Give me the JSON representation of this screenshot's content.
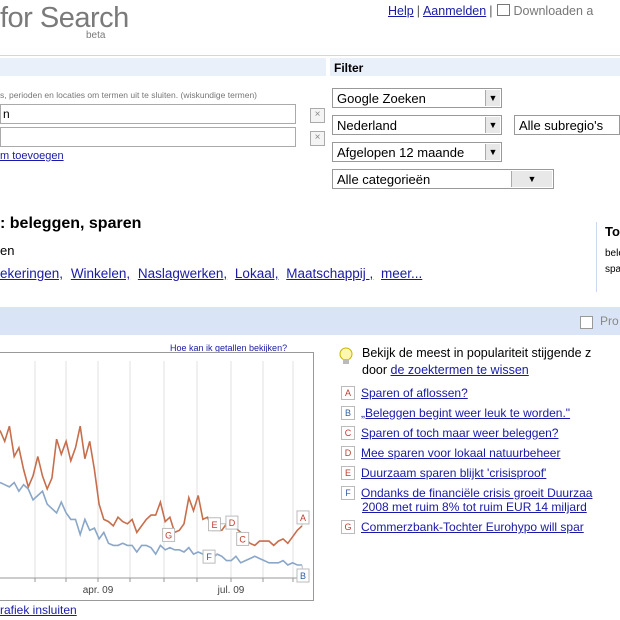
{
  "header": {
    "logo_text": "for Search",
    "beta": "beta",
    "links": {
      "help": "Help",
      "login": "Aanmelden",
      "download": "Downloaden a"
    }
  },
  "search_panel": {
    "hint": "s, perioden en locaties om termen uit te sluiten. (wiskundige termen)",
    "term1_value": "n",
    "term2_value": "",
    "add_term_link": "m toevoegen"
  },
  "filter": {
    "label": "Filter",
    "search_type": "Google Zoeken",
    "country": "Nederland",
    "subregion": "Alle subregio's",
    "period": "Afgelopen 12 maande",
    "category": "Alle categorieën"
  },
  "results": {
    "title": ": beleggen, sparen",
    "subtitle": "en",
    "categories": [
      "ekeringen,",
      "Winkelen,",
      "Naslagwerken,",
      "Lokaal,",
      "Maatschappij ,",
      "meer..."
    ],
    "right_box": {
      "title": "To",
      "line1": "bele",
      "line2": "spa"
    }
  },
  "band": {
    "label": "Pro"
  },
  "chart": {
    "how_link": "Hoe kan ik getallen bekijken?",
    "embed_link": "rafiek insluiten",
    "x_ticks": [
      "apr. 09",
      "jul. 09"
    ]
  },
  "chart_data": {
    "type": "line",
    "title": "",
    "xlabel": "",
    "ylabel": "",
    "x_ticks": [
      "apr. 09",
      "jul. 09"
    ],
    "series": [
      {
        "color": "#c76e4c",
        "values": [
          68,
          63,
          70,
          56,
          60,
          50,
          42,
          47,
          56,
          47,
          41,
          46,
          64,
          57,
          63,
          54,
          60,
          70,
          55,
          63,
          50,
          34,
          27,
          26,
          24,
          28,
          26,
          25,
          27,
          21,
          24,
          27,
          29,
          29,
          35,
          26,
          28,
          21,
          22,
          25,
          37,
          31,
          38,
          27,
          28,
          22,
          22,
          22,
          25,
          26,
          23,
          21,
          18,
          16,
          15,
          17,
          17,
          17,
          15,
          17,
          18,
          16,
          19,
          22,
          24
        ]
      },
      {
        "color": "#8aa6c8",
        "values": [
          44,
          43,
          42,
          44,
          40,
          43,
          41,
          36,
          38,
          40,
          34,
          32,
          30,
          35,
          30,
          27,
          27,
          20,
          27,
          22,
          23,
          18,
          21,
          16,
          15,
          15,
          16,
          15,
          15,
          12,
          15,
          15,
          14,
          11,
          15,
          13,
          14,
          13,
          13,
          12,
          14,
          11,
          12,
          11,
          12,
          9,
          11,
          10,
          8,
          8,
          10,
          7,
          8,
          9,
          10,
          9,
          8,
          7,
          7,
          7,
          8,
          6,
          7,
          6,
          6
        ]
      }
    ],
    "annotations": [
      {
        "letter": "A",
        "series": 0,
        "index": 64
      },
      {
        "letter": "B",
        "series": 1,
        "index": 64
      },
      {
        "letter": "C",
        "series": 0,
        "index": 51
      },
      {
        "letter": "D",
        "series": 0,
        "index": 50
      },
      {
        "letter": "E",
        "series": 0,
        "index": 48
      },
      {
        "letter": "F",
        "series": 1,
        "index": 46
      },
      {
        "letter": "G",
        "series": 0,
        "index": 37
      }
    ]
  },
  "trends": {
    "intro_line1": "Bekijk de meest in populariteit stijgende z",
    "intro_prefix": "door ",
    "intro_link": "de zoektermen te wissen",
    "items": [
      {
        "letter": "A",
        "text": "Sparen of aflossen?"
      },
      {
        "letter": "B",
        "text": "„Beleggen begint weer leuk te worden.\""
      },
      {
        "letter": "C",
        "text": "Sparen of toch maar weer beleggen?"
      },
      {
        "letter": "D",
        "text": "Mee sparen voor lokaal natuurbeheer"
      },
      {
        "letter": "E",
        "text": "Duurzaam sparen blijkt 'crisisproof'"
      },
      {
        "letter": "F",
        "text": "Ondanks de financiële crisis groeit Duurzaa",
        "text2": "2008 met ruim 8% tot ruim EUR 14 miljard"
      },
      {
        "letter": "G",
        "text": "Commerzbank-Tochter Eurohypo will spar"
      }
    ]
  },
  "colors": {
    "badge_red": "#c0392b",
    "badge_blue": "#2e5fa8",
    "band": "#d9e5f6"
  }
}
